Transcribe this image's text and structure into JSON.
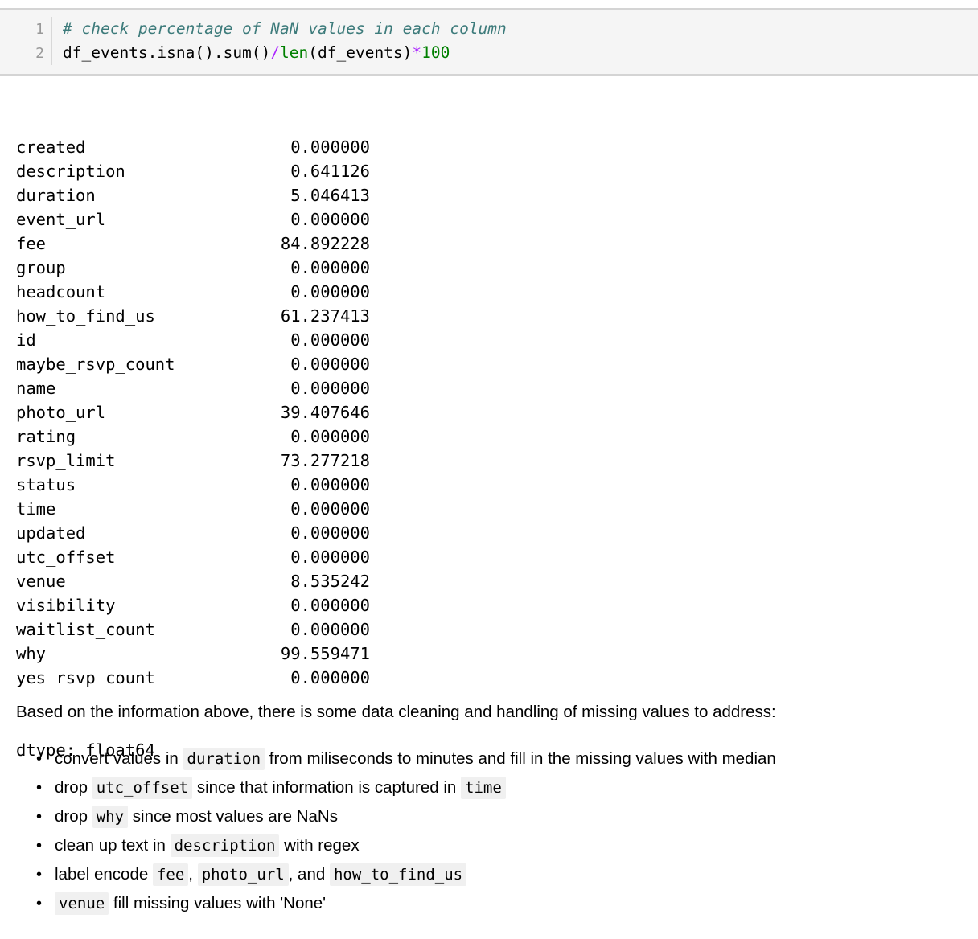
{
  "code_cell": {
    "line_numbers": [
      "1",
      "2"
    ],
    "line1_comment": "# check percentage of NaN values in each column",
    "line2": {
      "part1": "df_events.isna().sum()",
      "op_div": "/",
      "builtin": "len",
      "part2": "(df_events)",
      "op_mul": "*",
      "number": "100"
    },
    "colors": {
      "background": "#f5f5f5",
      "border": "#d4d4d4",
      "line_number": "#999999",
      "comment": "#3d7b7b",
      "operator": "#aa22ff",
      "builtin": "#008000",
      "number": "#008000"
    }
  },
  "output": {
    "rows": [
      {
        "name": "created",
        "value": "0.000000"
      },
      {
        "name": "description",
        "value": "0.641126"
      },
      {
        "name": "duration",
        "value": "5.046413"
      },
      {
        "name": "event_url",
        "value": "0.000000"
      },
      {
        "name": "fee",
        "value": "84.892228"
      },
      {
        "name": "group",
        "value": "0.000000"
      },
      {
        "name": "headcount",
        "value": "0.000000"
      },
      {
        "name": "how_to_find_us",
        "value": "61.237413"
      },
      {
        "name": "id",
        "value": "0.000000"
      },
      {
        "name": "maybe_rsvp_count",
        "value": "0.000000"
      },
      {
        "name": "name",
        "value": "0.000000"
      },
      {
        "name": "photo_url",
        "value": "39.407646"
      },
      {
        "name": "rating",
        "value": "0.000000"
      },
      {
        "name": "rsvp_limit",
        "value": "73.277218"
      },
      {
        "name": "status",
        "value": "0.000000"
      },
      {
        "name": "time",
        "value": "0.000000"
      },
      {
        "name": "updated",
        "value": "0.000000"
      },
      {
        "name": "utc_offset",
        "value": "0.000000"
      },
      {
        "name": "venue",
        "value": "8.535242"
      },
      {
        "name": "visibility",
        "value": "0.000000"
      },
      {
        "name": "waitlist_count",
        "value": "0.000000"
      },
      {
        "name": "why",
        "value": "99.559471"
      },
      {
        "name": "yes_rsvp_count",
        "value": "0.000000"
      }
    ],
    "dtype_line": "dtype: float64"
  },
  "markdown": {
    "paragraph": "Based on the information above, there is some data cleaning and handling of missing values to address:",
    "bullets": [
      {
        "t1": "convert values in ",
        "c1": "duration",
        "t2": " from miliseconds to minutes and fill in the missing values with median",
        "c2": "",
        "t3": "",
        "c3": "",
        "t4": ""
      },
      {
        "t1": "drop ",
        "c1": "utc_offset",
        "t2": " since that information is captured in ",
        "c2": "time",
        "t3": "",
        "c3": "",
        "t4": ""
      },
      {
        "t1": "drop ",
        "c1": "why",
        "t2": " since most values are NaNs",
        "c2": "",
        "t3": "",
        "c3": "",
        "t4": ""
      },
      {
        "t1": "clean up text in ",
        "c1": "description",
        "t2": " with regex",
        "c2": "",
        "t3": "",
        "c3": "",
        "t4": ""
      },
      {
        "t1": "label encode ",
        "c1": "fee",
        "t2": ", ",
        "c2": "photo_url",
        "t3": ", and ",
        "c3": "how_to_find_us",
        "t4": ""
      },
      {
        "t1": "",
        "c1": "venue",
        "t2": " fill missing values with 'None'",
        "c2": "",
        "t3": "",
        "c3": "",
        "t4": ""
      }
    ]
  }
}
